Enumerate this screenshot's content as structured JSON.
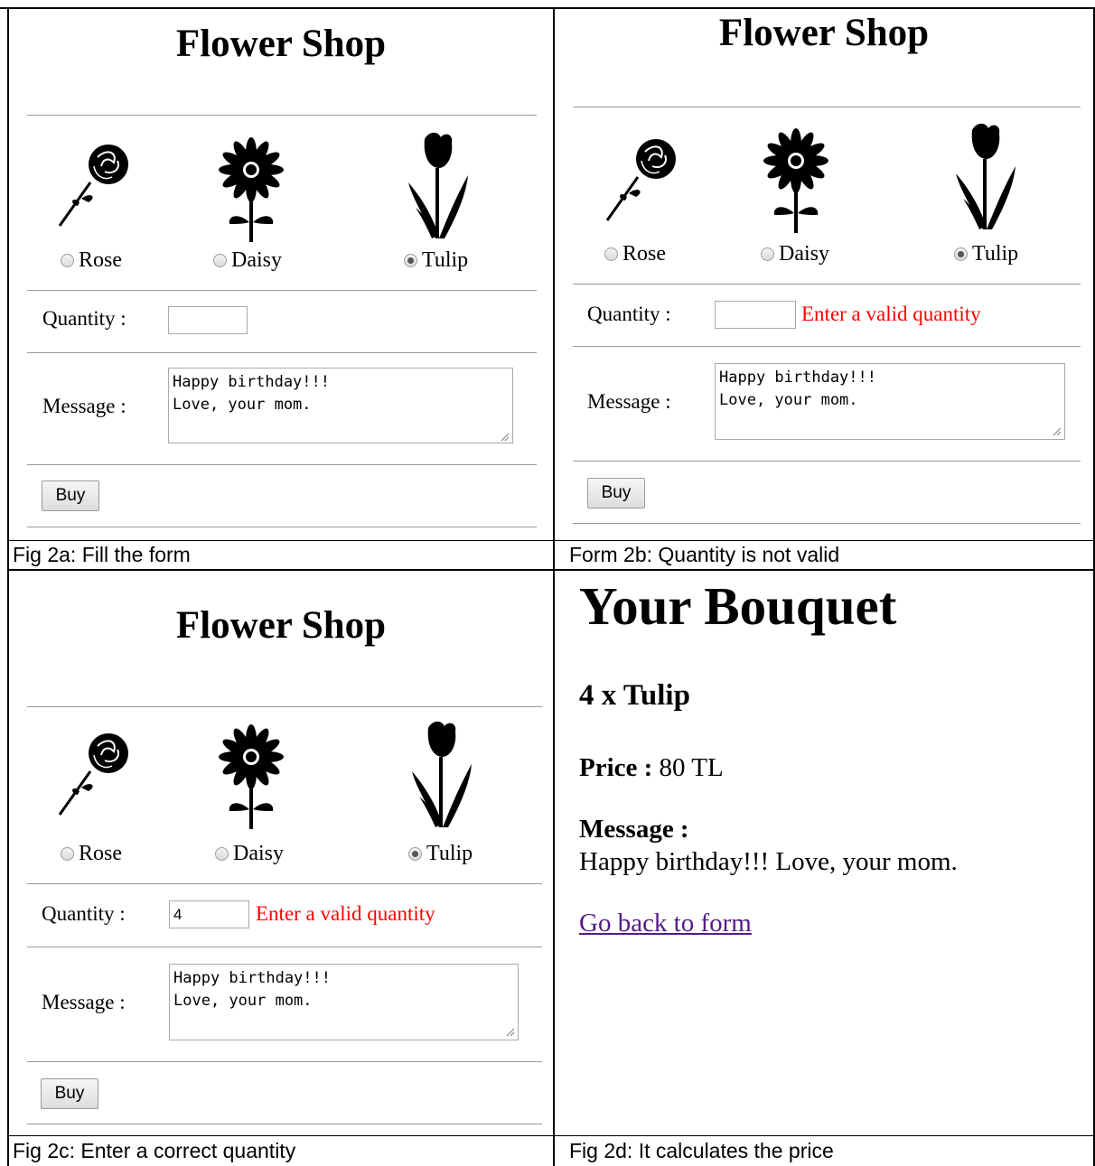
{
  "panel_a": {
    "title": "Flower Shop",
    "flowers": [
      {
        "label": "Rose",
        "icon": "rose-icon",
        "checked": false
      },
      {
        "label": "Daisy",
        "icon": "daisy-icon",
        "checked": false
      },
      {
        "label": "Tulip",
        "icon": "tulip-icon",
        "checked": true
      }
    ],
    "quantity_label": "Quantity :",
    "quantity_value": "",
    "message_label": "Message :",
    "message_value": "Happy birthday!!!\nLove, your mom.",
    "buy_label": "Buy",
    "caption": "Fig 2a: Fill the form"
  },
  "panel_b": {
    "title": "Flower Shop",
    "flowers": [
      {
        "label": "Rose",
        "icon": "rose-icon",
        "checked": false
      },
      {
        "label": "Daisy",
        "icon": "daisy-icon",
        "checked": false
      },
      {
        "label": "Tulip",
        "icon": "tulip-icon",
        "checked": true
      }
    ],
    "quantity_label": "Quantity :",
    "quantity_value": "",
    "error": "Enter a valid quantity",
    "message_label": "Message :",
    "message_value": "Happy birthday!!!\nLove, your mom.",
    "buy_label": "Buy",
    "caption": "Form 2b: Quantity is not valid"
  },
  "panel_c": {
    "title": "Flower Shop",
    "flowers": [
      {
        "label": "Rose",
        "icon": "rose-icon",
        "checked": false
      },
      {
        "label": "Daisy",
        "icon": "daisy-icon",
        "checked": false
      },
      {
        "label": "Tulip",
        "icon": "tulip-icon",
        "checked": true
      }
    ],
    "quantity_label": "Quantity :",
    "quantity_value": "4",
    "error": "Enter a valid quantity",
    "message_label": "Message :",
    "message_value": "Happy birthday!!!\nLove, your mom.",
    "buy_label": "Buy",
    "caption": "Fig 2c: Enter a correct quantity"
  },
  "panel_d": {
    "title": "Your Bouquet",
    "order": "4 x Tulip",
    "price_label": "Price :",
    "price_value": "80 TL",
    "message_label": "Message :",
    "message_value": "Happy birthday!!! Love, your mom.",
    "back_link": "Go back to form",
    "caption": "Fig 2d: It calculates the price"
  },
  "colors": {
    "error": "#ff0000",
    "link_visited": "#551a8b",
    "divider": "#9a9a9a"
  }
}
